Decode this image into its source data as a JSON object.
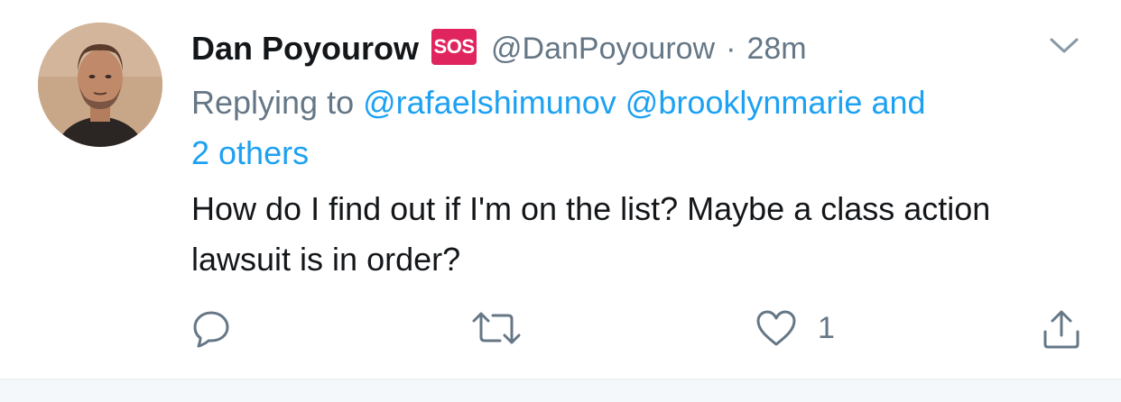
{
  "tweet": {
    "author_name": "Dan Poyourow",
    "badge": "SOS",
    "handle": "@DanPoyourow",
    "separator": "·",
    "time": "28m",
    "replying_prefix": "Replying to ",
    "replying_mentions": [
      "@rafaelshimunov",
      "@brooklynmarie"
    ],
    "replying_and": " and",
    "replying_others": "2 others",
    "text": "How do I find out if I'm on the list? Maybe a class action lawsuit is in order?"
  },
  "actions": {
    "reply_icon": "reply-icon",
    "retweet_icon": "retweet-icon",
    "like_icon": "heart-icon",
    "like_count": "1",
    "share_icon": "share-icon"
  },
  "colors": {
    "link": "#1da1f2",
    "secondary": "#657786",
    "badge": "#e0245e",
    "text": "#14171a"
  }
}
